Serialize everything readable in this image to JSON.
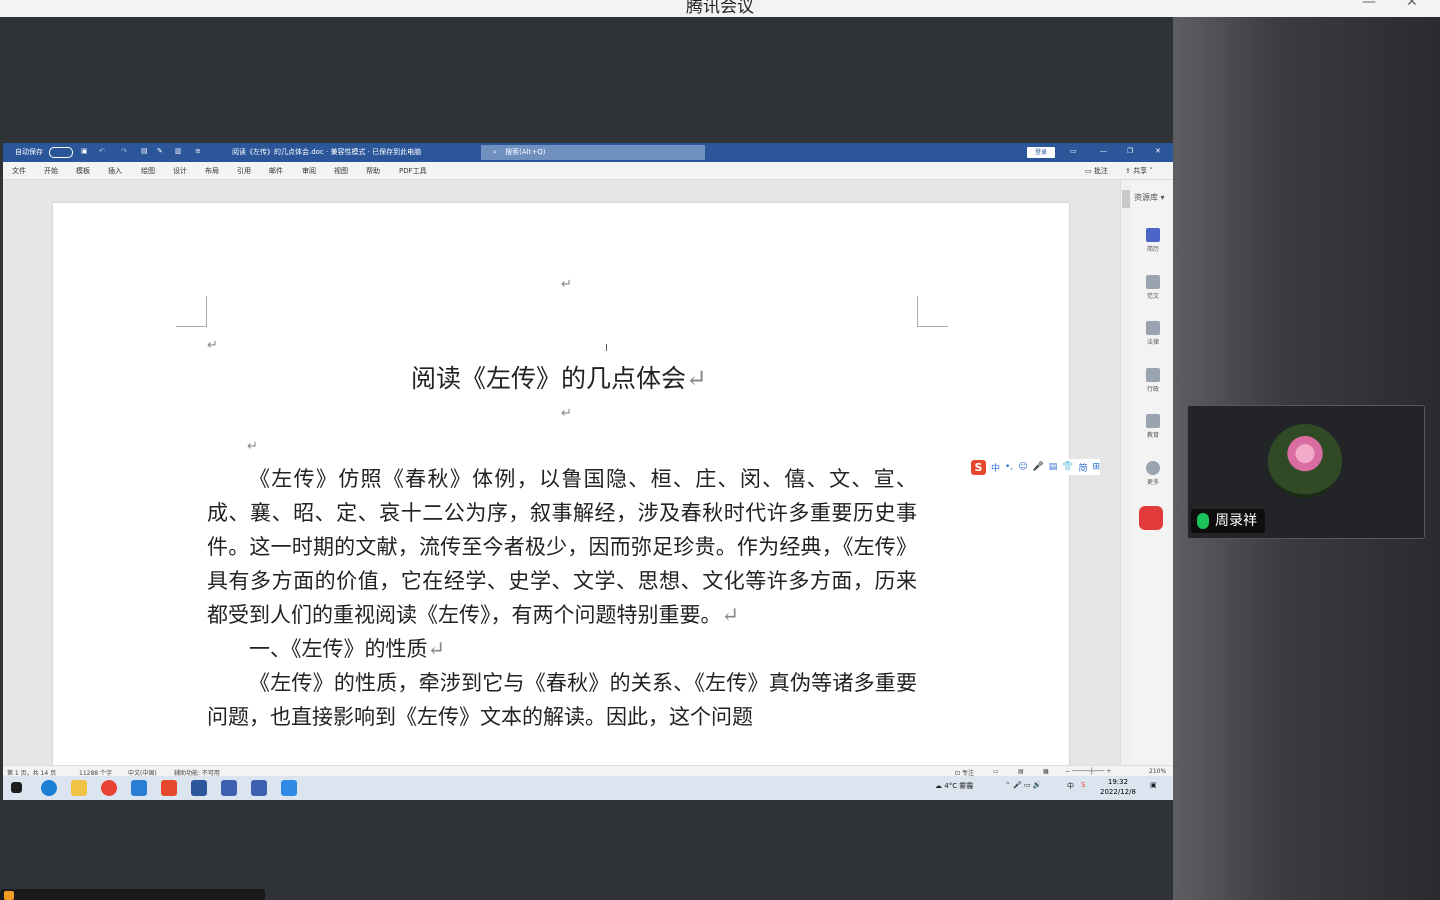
{
  "meeting": {
    "title": "腾讯会议",
    "participant_name": "周录祥"
  },
  "word": {
    "autosave_label": "自动保存",
    "doc_title": "阅读《左传》的几点体会.doc · 兼容性模式 · 已保存到此电脑",
    "search_placeholder": "搜索(Alt+Q)",
    "login_label": "登录",
    "ribbon_tabs": [
      "文件",
      "开始",
      "模板",
      "插入",
      "绘图",
      "设计",
      "布局",
      "引用",
      "邮件",
      "审阅",
      "视图",
      "帮助",
      "PDF工具"
    ],
    "comments_label": "批注",
    "share_label": "共享",
    "resource_label": "资源库",
    "side_items": [
      "简历",
      "范文",
      "法律",
      "行政",
      "教育",
      "更多"
    ]
  },
  "document": {
    "heading": "阅读《左传》的几点体会",
    "paragraph1": "《左传》仿照《春秋》体例，以鲁国隐、桓、庄、闵、僖、文、宣、成、襄、昭、定、哀十二公为序，叙事解经，涉及春秋时代许多重要历史事件。这一时期的文献，流传至今者极少，因而弥足珍贵。作为经典，《左传》具有多方面的价值，它在经学、史学、文学、思想、文化等许多方面，历来都受到人们的重视阅读《左传》，有两个问题特别重要。",
    "section1": "一、《左传》的性质",
    "paragraph2": "《左传》的性质，牵涉到它与《春秋》的关系、《左传》真伪等诸多重要问题，也直接影响到《左传》文本的解读。因此，这个问题",
    "para_mark": "↵"
  },
  "ime": {
    "items": [
      "中",
      "•,",
      "☺",
      "🎤",
      "▤",
      "👕",
      "简",
      "⊞"
    ]
  },
  "status": {
    "page": "第 1 页，共 14 页",
    "words": "11288 个字",
    "language": "中文(中国)",
    "accessibility": "辅助功能: 不可用",
    "focus": "专注",
    "zoom": "210%"
  },
  "taskbar": {
    "weather": "4°C 雾霾",
    "ime_indicator": "中",
    "time": "19:32",
    "date": "2022/12/8"
  },
  "colors": {
    "word_blue": "#2b579a",
    "mic_green": "#19c25a"
  }
}
